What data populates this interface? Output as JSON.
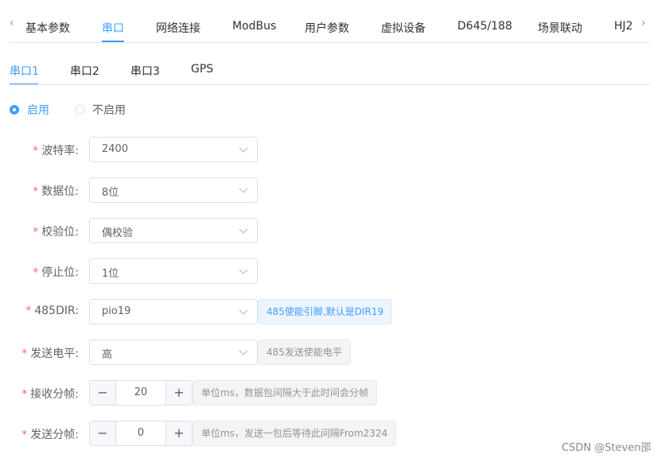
{
  "top_tabs": {
    "items": [
      "基本参数",
      "串口",
      "网络连接",
      "ModBus",
      "用户参数",
      "虚拟设备",
      "D645/188",
      "场景联动",
      "HJ2"
    ],
    "active": "串口",
    "prev_arrow": "‹",
    "next_arrow": "›"
  },
  "sub_tabs": {
    "items": [
      "串口1",
      "串口2",
      "串口3",
      "GPS"
    ],
    "active": "串口1"
  },
  "enable": {
    "options": [
      "启用",
      "不启用"
    ],
    "selected": "启用"
  },
  "form": {
    "required_mark": "*",
    "baud_rate": {
      "label": "波特率:",
      "value": "2400"
    },
    "data_bits": {
      "label": "数据位:",
      "value": "8位"
    },
    "parity": {
      "label": "校验位:",
      "value": "偶校验"
    },
    "stop_bits": {
      "label": "停止位:",
      "value": "1位"
    },
    "dir485": {
      "label": "485DIR:",
      "value": "pio19",
      "hint": "485使能引脚,默认是DIR19"
    },
    "send_level": {
      "label": "发送电平:",
      "value": "高",
      "hint": "485发送使能电平"
    },
    "recv_frame": {
      "label": "接收分帧:",
      "value": "20",
      "hint": "单位ms，数据包间隔大于此时间会分帧"
    },
    "send_frame": {
      "label": "发送分帧:",
      "value": "0",
      "hint": "单位ms，发送一包后等待此间隔From2324"
    }
  },
  "stepper": {
    "minus": "−",
    "plus": "+"
  },
  "watermark": "CSDN @Steven邵",
  "colors": {
    "accent": "#409eff",
    "required": "#f56c6c",
    "border": "#dcdfe6"
  }
}
